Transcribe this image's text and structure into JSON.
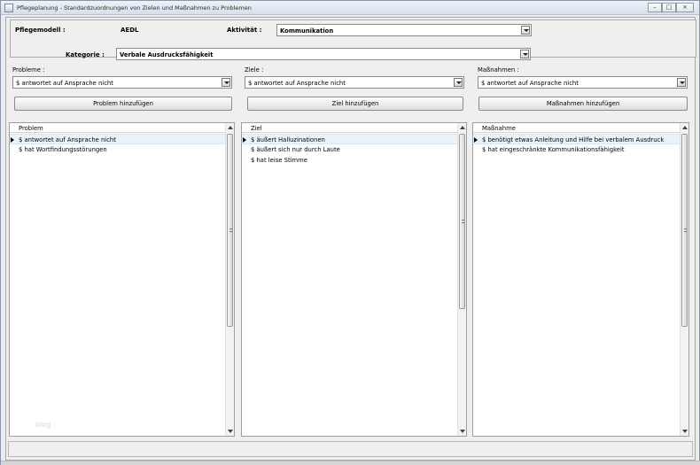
{
  "window": {
    "title": "Pflegeplanung - Standardzuordnungen von Zielen und Maßnahmen zu Problemen",
    "minimize": "–",
    "maximize": "□",
    "close": "×"
  },
  "header": {
    "pflegemodell_label": "Pflegemodell :",
    "pflegemodell_value": "AEDL",
    "aktivitaet_label": "Aktivität :",
    "aktivitaet_value": "Kommunikation",
    "kategorie_label": "Kategorie :",
    "kategorie_value": "Verbale Ausdrucksfähigkeit"
  },
  "problems": {
    "label": "Probleme :",
    "selected": "$ antwortet auf Ansprache nicht",
    "button": "Problem hinzufügen",
    "list_header": "Problem",
    "rows": [
      "$ antwortet auf Ansprache nicht",
      "$ hat Wortfindungsstörungen"
    ]
  },
  "goals": {
    "label": "Ziele :",
    "selected": "$ antwortet auf Ansprache nicht",
    "button": "Ziel hinzufügen",
    "list_header": "Ziel",
    "rows": [
      "$ äußert Halluzinationen",
      "$ äußert sich nur durch Laute",
      "$ hat leise Stimme"
    ]
  },
  "measures": {
    "label": "Maßnahmen :",
    "selected": "$ antwortet auf Ansprache nicht",
    "button": "Maßnahmen hinzufügen",
    "list_header": "Maßnahme",
    "rows": [
      "$ benötigt etwas Anleitung und Hilfe bei verbalem Ausdruck",
      "$ hat eingeschränkte Kommunikationsfähigkeit"
    ]
  },
  "watermark": "blog"
}
